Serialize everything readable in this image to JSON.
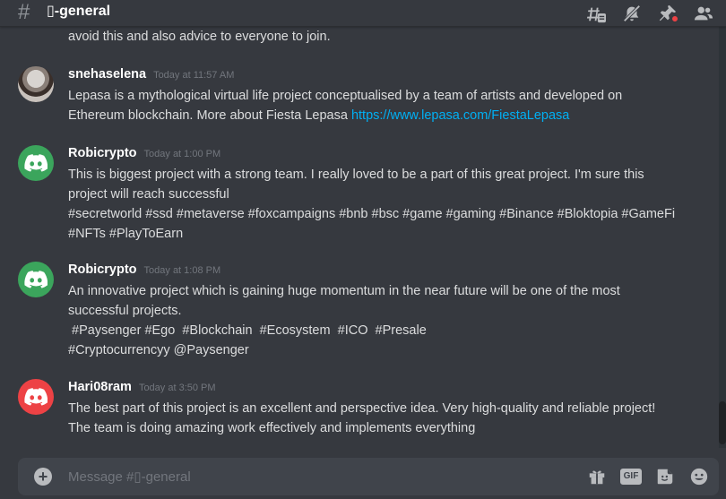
{
  "channel": {
    "hash_glyph": "#",
    "name": "▯-general"
  },
  "header_icons": [
    "threads-icon",
    "mute-bell-icon",
    "pin-icon",
    "members-icon"
  ],
  "continuation_text": "avoid this and also advice to everyone to join.",
  "messages": [
    {
      "author": "snehaselena",
      "timestamp": "Today at 11:57 AM",
      "avatar": "photo",
      "text": "Lepasa is a mythological virtual life project conceptualised by a team of artists and developed on Ethereum blockchain. More about Fiesta Lepasa ",
      "link": "https://www.lepasa.com/FiestaLepasa"
    },
    {
      "author": "Robicrypto",
      "timestamp": "Today at 1:00 PM",
      "avatar": "discord-green",
      "line1": "This is biggest project with a strong team. I really loved to be a part of this great project. I'm sure this project will reach successful",
      "line2": "#secretworld #ssd #metaverse #foxcampaigns #bnb #bsc #game #gaming #Binance #Bloktopia #GameFi #NFTs #PlayToEarn"
    },
    {
      "author": "Robicrypto",
      "timestamp": "Today at 1:08 PM",
      "avatar": "discord-green",
      "line1": "An innovative project which is gaining huge momentum in the near future will be one of the most successful projects.",
      "line2": " #Paysenger #Ego  #Blockchain  #Ecosystem  #ICO  #Presale",
      "line3": "#Cryptocurrencyy @Paysenger"
    },
    {
      "author": "Hari08ram",
      "timestamp": "Today at 3:50 PM",
      "avatar": "discord-red",
      "text": "The best part of this project is an excellent and perspective idea. Very high-quality and reliable project! The team is doing amazing work effectively and implements everything"
    }
  ],
  "composer": {
    "placeholder": "Message #▯-general",
    "gif_label": "GIF",
    "icons": [
      "gift-icon",
      "gif-icon",
      "sticker-icon",
      "emoji-icon"
    ]
  },
  "colors": {
    "background": "#36393f",
    "link": "#00b0f4",
    "discord_green": "#3ba55c",
    "discord_red": "#ed4245"
  }
}
